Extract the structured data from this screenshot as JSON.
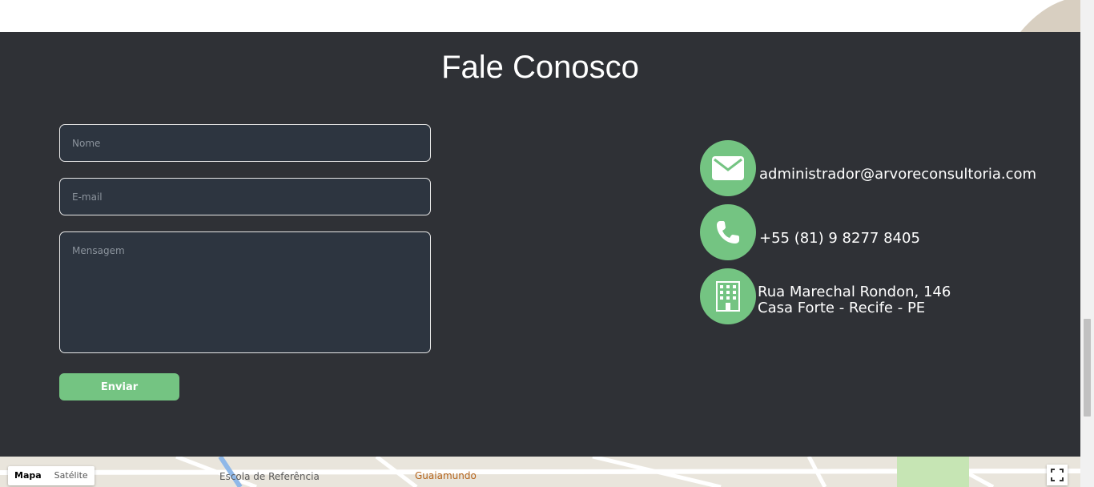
{
  "contact": {
    "title": "Fale Conosco",
    "form": {
      "name_placeholder": "Nome",
      "email_placeholder": "E-mail",
      "message_placeholder": "Mensagem",
      "submit_label": "Enviar"
    },
    "info": {
      "email": "administrador@arvoreconsultoria.com",
      "phone": "+55 (81) 9 8277 8405",
      "address_line1": "Rua Marechal Rondon, 146",
      "address_line2": "Casa Forte - Recife - PE"
    },
    "icons": [
      "envelope-icon",
      "phone-icon",
      "building-icon"
    ]
  },
  "map": {
    "type_controls": [
      "Mapa",
      "Satélite"
    ],
    "active_type": "Mapa",
    "labels": [
      "Escola de Referência",
      "Guaiamundo"
    ]
  },
  "colors": {
    "section_bg": "#2f3136",
    "accent_green": "#74c482",
    "field_bg": "#2d3540"
  }
}
